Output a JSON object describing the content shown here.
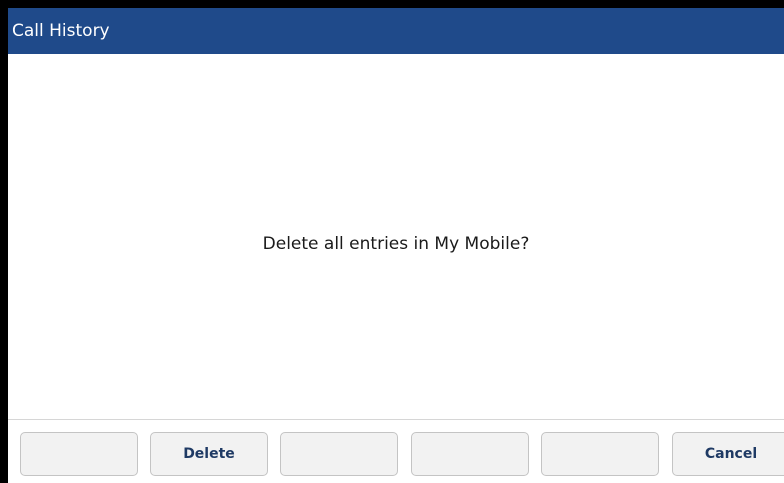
{
  "header": {
    "title": "Call History"
  },
  "dialog": {
    "message": "Delete all entries in My Mobile?"
  },
  "softkeys": [
    {
      "label": ""
    },
    {
      "label": "Delete"
    },
    {
      "label": ""
    },
    {
      "label": ""
    },
    {
      "label": ""
    },
    {
      "label": "Cancel"
    }
  ],
  "colors": {
    "header_background": "#1f4a8a",
    "header_text": "#ffffff",
    "softkey_text": "#1f3a64",
    "softkey_background": "#f2f2f2"
  }
}
